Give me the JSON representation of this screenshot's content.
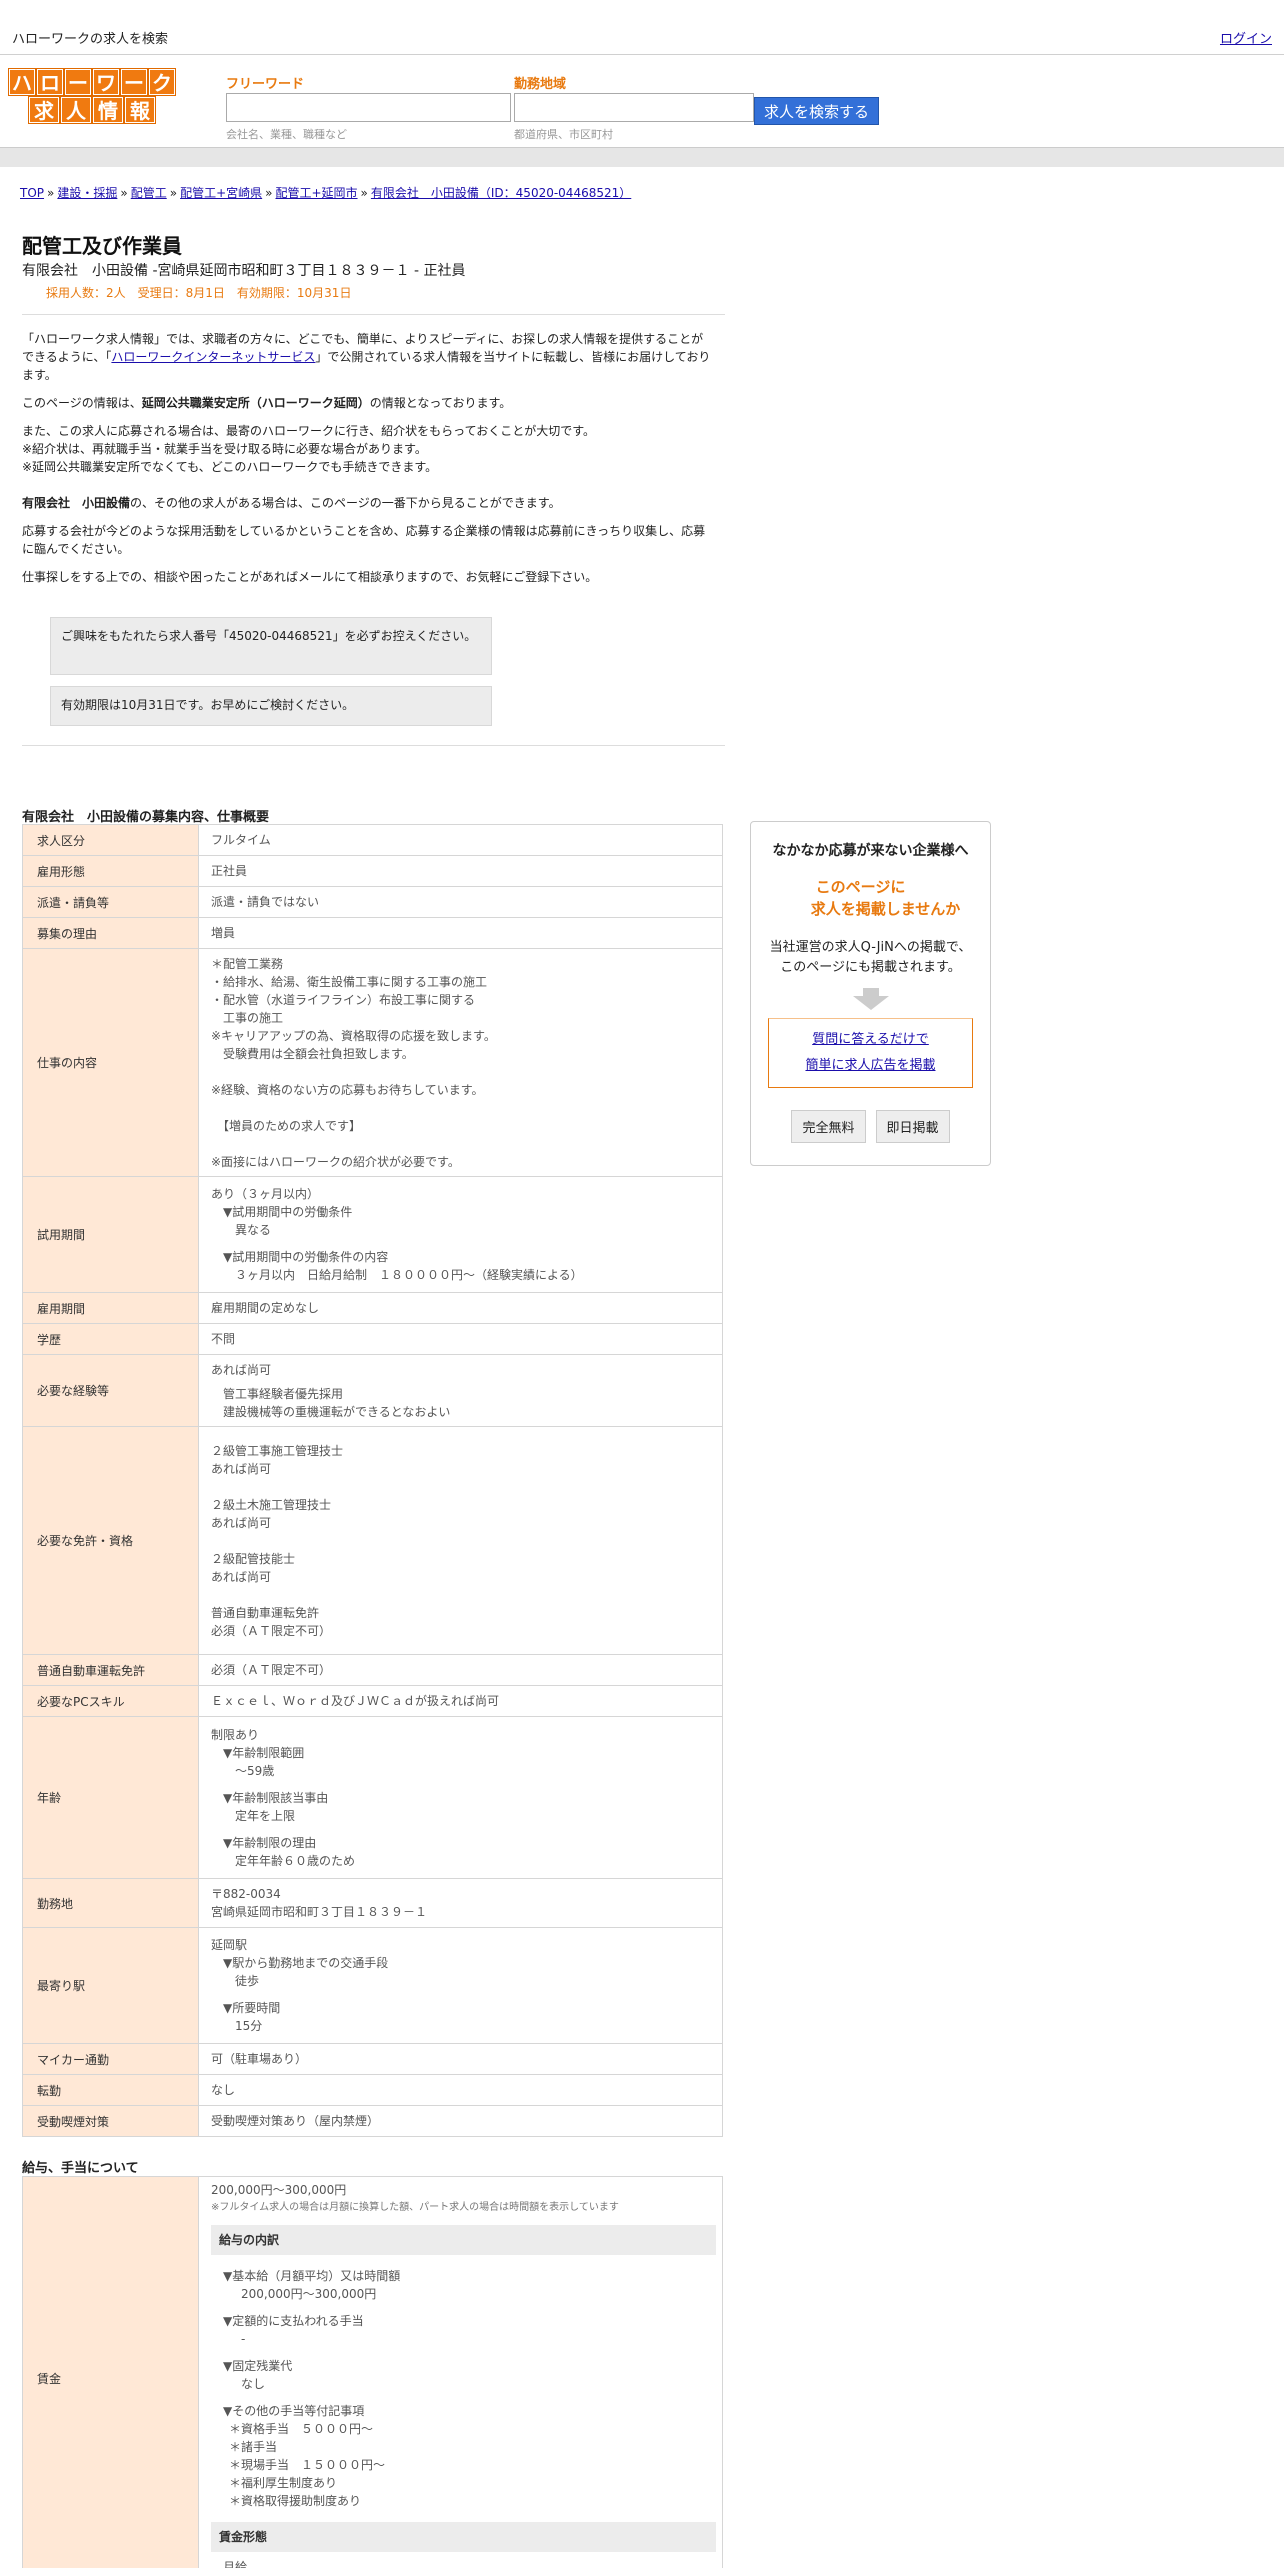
{
  "topbar": {
    "site_title": "ハローワークの求人を検索",
    "login": "ログイン"
  },
  "logo": {
    "row1": [
      "ハ",
      "ロ",
      "ー",
      "ワ",
      "ー",
      "ク"
    ],
    "row2": [
      "求",
      "人",
      "情",
      "報"
    ]
  },
  "search": {
    "keyword_label": "フリーワード",
    "keyword_hint": "会社名、業種、職種など",
    "area_label": "勤務地域",
    "area_hint": "都道府県、市区町村",
    "button": "求人を検索する"
  },
  "breadcrumb": [
    "TOP",
    "建設・採掘",
    "配管工",
    "配管工+宮崎県",
    "配管工+延岡市",
    "有限会社　小田設備（ID：45020-04468521）"
  ],
  "job": {
    "title": "配管工及び作業員",
    "company_line": "有限会社　小田設備 -宮崎県延岡市昭和町３丁目１８３９－１ - 正社員",
    "meta": "採用人数：2人　受理日：8月1日　有効期限：10月31日"
  },
  "intro": {
    "p1_a": "「ハローワーク求人情報」では、求職者の方々に、どこでも、簡単に、よりスピーディに、お探しの求人情報を提供することができるように、「",
    "p1_link": "ハローワークインターネットサービス",
    "p1_b": "」で公開されている求人情報を当サイトに転載し、皆様にお届けしております。",
    "p2_a": "このページの情報は、",
    "p2_bold": "延岡公共職業安定所（ハローワーク延岡）",
    "p2_b": "の情報となっております。",
    "p3_1": "また、この求人に応募される場合は、最寄のハローワークに行き、紹介状をもらっておくことが大切です。",
    "p3_2": "※紹介状は、再就職手当・就業手当を受け取る時に必要な場合があります。",
    "p3_3": "※延岡公共職業安定所でなくても、どこのハローワークでも手続きできます。",
    "p4_bold": "有限会社　小田設備",
    "p4_b": "の、その他の求人がある場合は、このページの一番下から見ることができます。",
    "p5": "応募する会社が今どのような採用活動をしているかということを含め、応募する企業様の情報は応募前にきっちり収集し、応募に臨んでください。",
    "p6": "仕事探しをする上での、相談や困ったことがあればメールにて相談承りますので、お気軽にご登録下さい。"
  },
  "notices": {
    "n1": "ご興味をもたれたら求人番号「45020-04468521」を必ずお控えください。",
    "n2": "有効期限は10月31日です。お早めにご検討ください。"
  },
  "summary": {
    "title": "有限会社　小田設備の募集内容、仕事概要",
    "rows": {
      "kubun": {
        "label": "求人区分",
        "value": "フルタイム"
      },
      "keitai": {
        "label": "雇用形態",
        "value": "正社員"
      },
      "haken": {
        "label": "派遣・請負等",
        "value": "派遣・請負ではない"
      },
      "riyu": {
        "label": "募集の理由",
        "value": "増員"
      },
      "naiyo": {
        "label": "仕事の内容",
        "lines": [
          "＊配管工業務",
          "・給排水、給湯、衛生設備工事に関する工事の施工",
          "・配水管（水道ライフライン）布設工事に関する",
          "　工事の施工",
          "※キャリアアップの為、資格取得の応援を致します。",
          "　受験費用は全額会社負担致します。",
          "",
          "※経験、資格のない方の応募もお待ちしています。",
          "",
          "　【増員のための求人です】",
          "",
          "※面接にはハローワークの紹介状が必要です。"
        ]
      },
      "shiyo": {
        "label": "試用期間",
        "l1": "あり（３ヶ月以内）",
        "l2": "▼試用期間中の労働条件",
        "l3": "異なる",
        "l4": "▼試用期間中の労働条件の内容",
        "l5": "３ヶ月以内　日給月給制　１８００００円～（経験実績による）"
      },
      "koyo_kikan": {
        "label": "雇用期間",
        "value": "雇用期間の定めなし"
      },
      "gakureki": {
        "label": "学歴",
        "value": "不問"
      },
      "keiken": {
        "label": "必要な経験等",
        "l1": "あれば尚可",
        "l2": "管工事経験者優先採用",
        "l3": "建設機械等の重機運転ができるとなおよい"
      },
      "shikaku": {
        "label": "必要な免許・資格",
        "lines": [
          "２級管工事施工管理技士",
          "あれば尚可",
          "",
          "２級土木施工管理技士",
          "あれば尚可",
          "",
          "２級配管技能士",
          "あれば尚可",
          "",
          "普通自動車運転免許",
          "必須（ＡＴ限定不可）"
        ]
      },
      "futsu": {
        "label": "普通自動車運転免許",
        "value": "必須（ＡＴ限定不可）"
      },
      "pc": {
        "label": "必要なPCスキル",
        "value": "Ｅｘｃｅｌ、Ｗｏｒｄ及びＪＷＣａｄが扱えれば尚可"
      },
      "nenrei": {
        "label": "年齢",
        "l1": "制限あり",
        "l2": "▼年齢制限範囲",
        "l3": "〜59歳",
        "l4": "▼年齢制限該当事由",
        "l5": "定年を上限",
        "l6": "▼年齢制限の理由",
        "l7": "定年年齢６０歳のため"
      },
      "kinmuchi": {
        "label": "勤務地",
        "l1": "〒882-0034",
        "l2": "宮崎県延岡市昭和町３丁目１８３９－１"
      },
      "eki": {
        "label": "最寄り駅",
        "l1": "延岡駅",
        "l2": "▼駅から勤務地までの交通手段",
        "l3": "徒歩",
        "l4": "▼所要時間",
        "l5": "15分"
      },
      "mycar": {
        "label": "マイカー通勤",
        "value": "可（駐車場あり）"
      },
      "tenkin": {
        "label": "転勤",
        "value": "なし"
      },
      "judo": {
        "label": "受動喫煙対策",
        "value": "受動喫煙対策あり（屋内禁煙）"
      }
    }
  },
  "pay": {
    "title": "給与、手当について",
    "label": "賃金",
    "range": "200,000円〜300,000円",
    "note": "※フルタイム求人の場合は月額に換算した額、パート求人の場合は時間額を表示しています",
    "sub1": "給与の内訳",
    "b1": "▼基本給（月額平均）又は時間額",
    "b1v": "200,000円〜300,000円",
    "b2": "▼定額的に支払われる手当",
    "b2v": "-",
    "b3": "▼固定残業代",
    "b3v": "なし",
    "b4": "▼その他の手当等付記事項",
    "b4v": [
      "＊資格手当　５０００円～",
      "＊諸手当",
      "＊現場手当　１５０００円～",
      "＊福利厚生制度あり",
      "＊資格取得援助制度あり"
    ],
    "sub2": "賃金形態",
    "form": "月給"
  },
  "sidebox": {
    "t1": "なかなか応募が来ない企業様へ",
    "t2a": "このページに",
    "t2b": "求人を掲載しませんか",
    "t3a": "当社運営の求人Q-JiNへの掲載で、",
    "t3b": "このページにも掲載されます。",
    "link1": "質問に答えるだけで",
    "link2": "簡単に求人広告を掲載",
    "btn1": "完全無料",
    "btn2": "即日掲載"
  }
}
